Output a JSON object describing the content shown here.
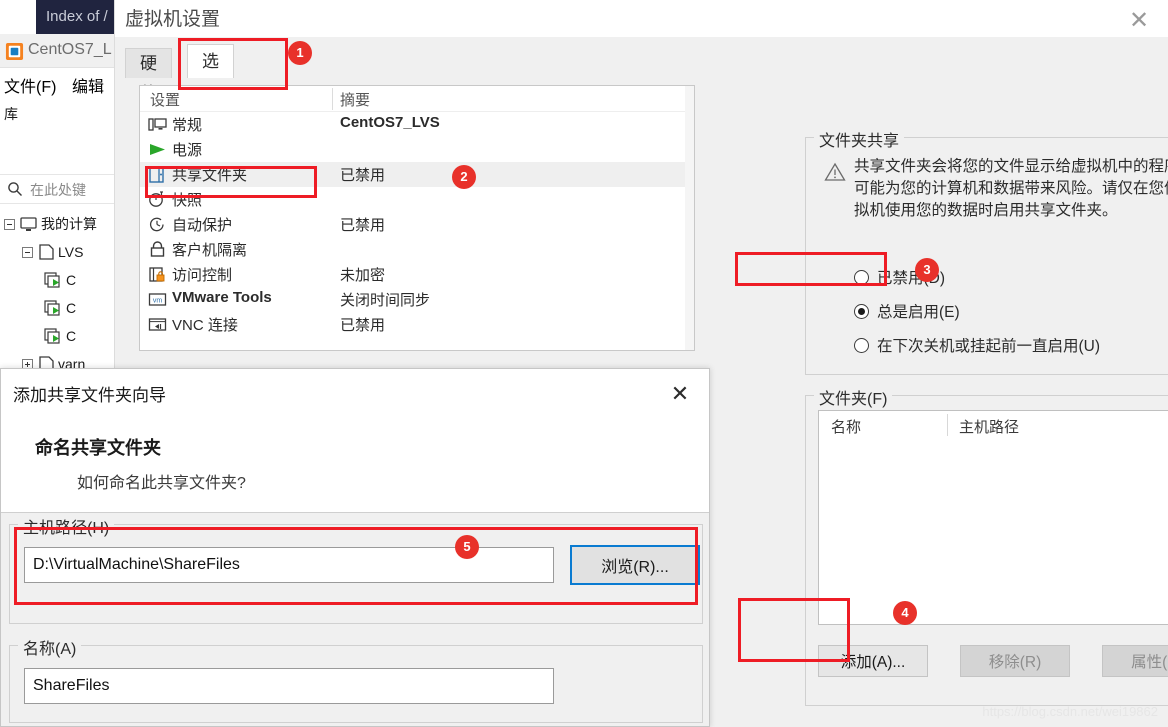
{
  "background": {
    "browser_tab_title": "Index of /",
    "app_title": "CentOS7_L",
    "menu": [
      {
        "label": "文件(F)"
      },
      {
        "label": "编辑"
      }
    ],
    "library_label": "库",
    "search_placeholder": "在此处键",
    "tree": [
      {
        "label": "我的计算",
        "icon": "monitor-icon",
        "expander": "minus",
        "indent": 4
      },
      {
        "label": "LVS",
        "icon": "folder-icon",
        "expander": "minus",
        "indent": 22
      },
      {
        "label": "C",
        "icon": "vm-icon",
        "expander": "none",
        "indent": 44
      },
      {
        "label": "C",
        "icon": "vm-icon",
        "expander": "none",
        "indent": 44
      },
      {
        "label": "C",
        "icon": "vm-icon",
        "expander": "none",
        "indent": 44
      },
      {
        "label": "varn",
        "icon": "folder-icon",
        "expander": "plus",
        "indent": 22
      }
    ]
  },
  "vm_settings": {
    "title": "虚拟机设置",
    "close_label": "✕",
    "tabs": [
      {
        "label": "硬件",
        "active": false
      },
      {
        "label": "选项",
        "active": true
      }
    ],
    "list_headers": {
      "name": "设置",
      "summary": "摘要"
    },
    "list_rows": [
      {
        "label": "常规",
        "summary": "CentOS7_LVS",
        "icon": "general-monitor-icon",
        "selected": false
      },
      {
        "label": "电源",
        "summary": "",
        "icon": "power-play-icon",
        "selected": false
      },
      {
        "label": "共享文件夹",
        "summary": "已禁用",
        "icon": "shared-folder-icon",
        "selected": true
      },
      {
        "label": "快照",
        "summary": "",
        "icon": "snapshot-clock-icon",
        "selected": false
      },
      {
        "label": "自动保护",
        "summary": "已禁用",
        "icon": "autoprotect-clock-icon",
        "selected": false
      },
      {
        "label": "客户机隔离",
        "summary": "",
        "icon": "lock-icon",
        "selected": false
      },
      {
        "label": "访问控制",
        "summary": "未加密",
        "icon": "access-control-icon",
        "selected": false
      },
      {
        "label": "VMware Tools",
        "summary": "关闭时间同步",
        "icon": "vmware-tools-icon",
        "selected": false
      },
      {
        "label": "VNC 连接",
        "summary": "已禁用",
        "icon": "vnc-icon",
        "selected": false
      }
    ],
    "folder_sharing": {
      "group_title": "文件夹共享",
      "warning_icon": "warning-triangle-icon",
      "warning_text": "共享文件夹会将您的文件显示给虚拟机中的程序。这可能为您的计算机和数据带来风险。请仅在您信任虚拟机使用您的数据时启用共享文件夹。",
      "options": [
        {
          "label": "已禁用(D)",
          "selected": false
        },
        {
          "label": "总是启用(E)",
          "selected": true
        },
        {
          "label": "在下次关机或挂起前一直启用(U)",
          "selected": false
        }
      ]
    },
    "folders": {
      "group_title": "文件夹(F)",
      "columns": [
        "名称",
        "主机路径"
      ],
      "rows": [],
      "buttons": [
        {
          "label": "添加(A)...",
          "enabled": true
        },
        {
          "label": "移除(R)",
          "enabled": false
        },
        {
          "label": "属性(P)",
          "enabled": false
        }
      ]
    }
  },
  "wizard": {
    "title": "添加共享文件夹向导",
    "close_label": "✕",
    "heading": "命名共享文件夹",
    "subheading": "如何命名此共享文件夹?",
    "host_path": {
      "group_title": "主机路径(H)",
      "value": "D:\\VirtualMachine\\ShareFiles",
      "browse_button": "浏览(R)..."
    },
    "name": {
      "group_title": "名称(A)",
      "value": "ShareFiles"
    }
  },
  "annotations": [
    {
      "number": "1"
    },
    {
      "number": "2"
    },
    {
      "number": "3"
    },
    {
      "number": "4"
    },
    {
      "number": "5"
    }
  ],
  "watermark": "https://blog.csdn.net/wei19862",
  "colors": {
    "accent_red": "#e8312a",
    "selection_gray": "#efefef",
    "dialog_bg": "#f0f0f0",
    "browse_border_blue": "#0a7bd1"
  }
}
